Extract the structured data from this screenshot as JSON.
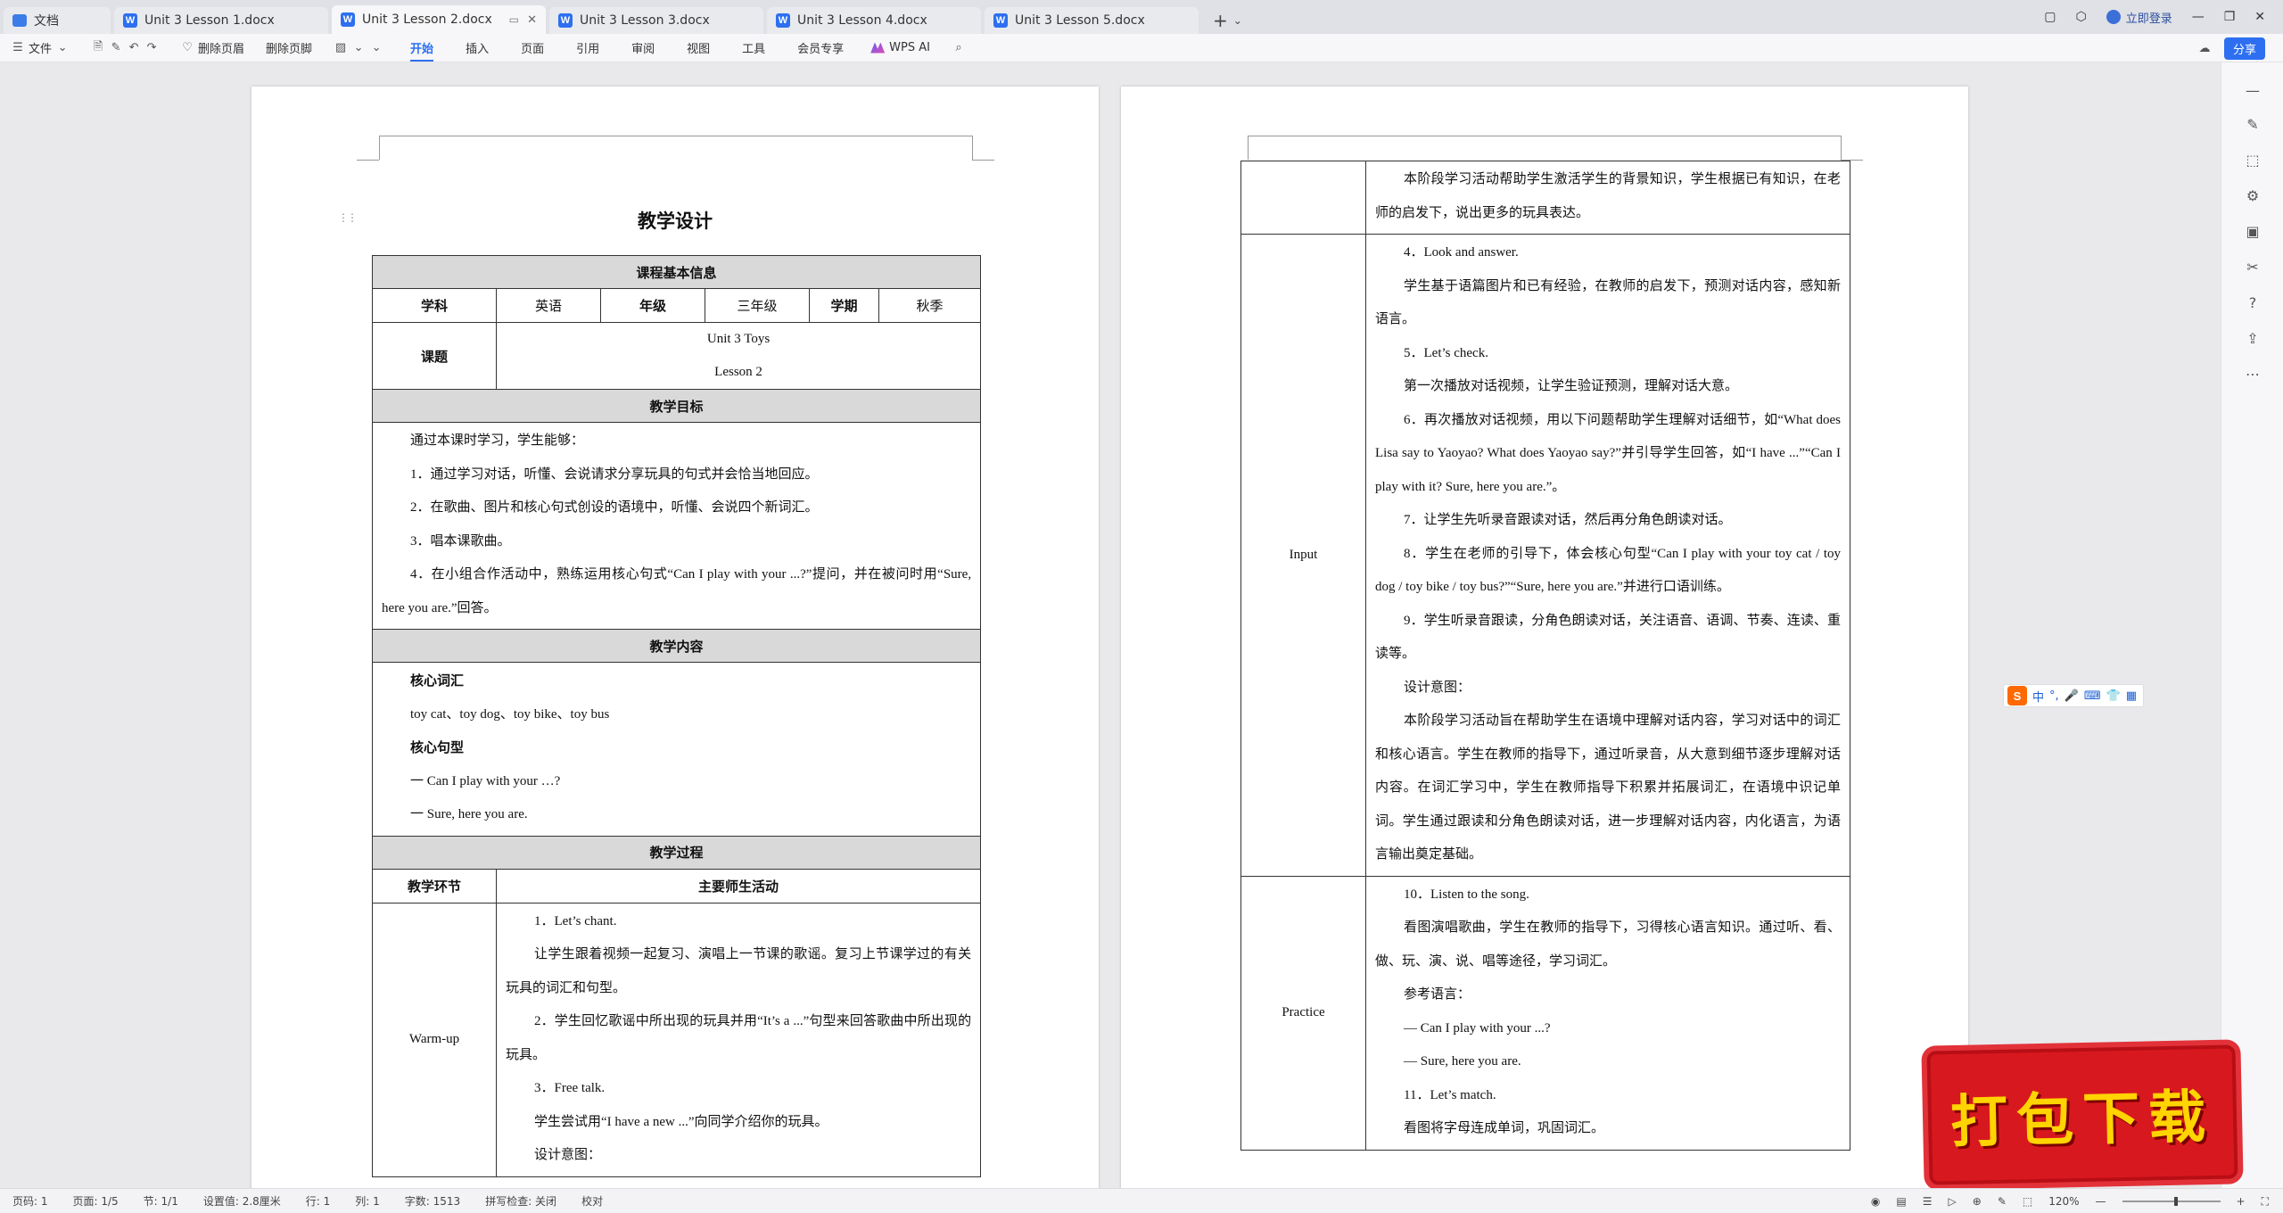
{
  "tabs": [
    {
      "label": "文档",
      "type": "home"
    },
    {
      "label": "Unit 3 Lesson 1.docx",
      "type": "doc"
    },
    {
      "label": "Unit 3 Lesson 2.docx",
      "type": "doc",
      "active": true
    },
    {
      "label": "Unit 3 Lesson 3.docx",
      "type": "doc"
    },
    {
      "label": "Unit 3 Lesson 4.docx",
      "type": "doc"
    },
    {
      "label": "Unit 3 Lesson 5.docx",
      "type": "doc"
    }
  ],
  "topbar": {
    "login": "立即登录",
    "add_tab": "+"
  },
  "toolbar": {
    "file": "文件",
    "delete_header": "删除页眉",
    "delete_footer": "删除页脚",
    "menus": [
      "开始",
      "插入",
      "页面",
      "引用",
      "审阅",
      "视图",
      "工具",
      "会员专享"
    ],
    "wps_ai": "WPS AI",
    "share": "分享"
  },
  "doc1": {
    "title": "教学设计",
    "basic_info": "课程基本信息",
    "subject_label": "学科",
    "subject": "英语",
    "grade_label": "年级",
    "grade": "三年级",
    "term_label": "学期",
    "term": "秋季",
    "topic_label": "课题",
    "topic_line1": "Unit 3 Toys",
    "topic_line2": "Lesson 2",
    "goals_header": "教学目标",
    "goals_intro": "通过本课时学习，学生能够：",
    "goal1": "1．通过学习对话，听懂、会说请求分享玩具的句式并会恰当地回应。",
    "goal2": "2．在歌曲、图片和核心句式创设的语境中，听懂、会说四个新词汇。",
    "goal3": "3．唱本课歌曲。",
    "goal4": "4．在小组合作活动中，熟练运用核心句式“Can I play with your ...?”提问，并在被问时用“Sure, here you are.”回答。",
    "content_header": "教学内容",
    "vocab_label": "核心词汇",
    "vocab": "toy cat、toy dog、toy bike、toy bus",
    "pattern_label": "核心句型",
    "pattern1": "一  Can I play with your …?",
    "pattern2": "一  Sure, here you are.",
    "process_header": "教学过程",
    "stage_col": "教学环节",
    "activity_col": "主要师生活动",
    "warmup": "Warm-up",
    "w1": "1．Let’s chant.",
    "w2": "让学生跟着视频一起复习、演唱上一节课的歌谣。复习上节课学过的有关玩具的词汇和句型。",
    "w3": "2．学生回忆歌谣中所出现的玩具并用“It’s a ...”句型来回答歌曲中所出现的玩具。",
    "w4": "3．Free talk.",
    "w5": "学生尝试用“I have a new ...”向同学介绍你的玩具。",
    "w6": "设计意图："
  },
  "doc2": {
    "top_text": "本阶段学习活动帮助学生激活学生的背景知识，学生根据已有知识，在老师的启发下，说出更多的玩具表达。",
    "input_label": "Input",
    "i1": "4．Look and answer.",
    "i2": "学生基于语篇图片和已有经验，在教师的启发下，预测对话内容，感知新语言。",
    "i3": "5．Let’s check.",
    "i4": "第一次播放对话视频，让学生验证预测，理解对话大意。",
    "i5": "6．再次播放对话视频，用以下问题帮助学生理解对话细节，如“What does Lisa say to Yaoyao? What does Yaoyao say?”并引导学生回答，如“I have ...”“Can I play with it? Sure, here you are.”。",
    "i6": "7．让学生先听录音跟读对话，然后再分角色朗读对话。",
    "i7": "8．学生在老师的引导下，体会核心句型“Can I play with your toy cat / toy dog / toy bike / toy bus?”“Sure, here you are.”并进行口语训练。",
    "i8": "9．学生听录音跟读，分角色朗读对话，关注语音、语调、节奏、连读、重读等。",
    "i9": "设计意图：",
    "i10": "本阶段学习活动旨在帮助学生在语境中理解对话内容，学习对话中的词汇和核心语言。学生在教师的指导下，通过听录音，从大意到细节逐步理解对话内容。在词汇学习中，学生在教师指导下积累并拓展词汇，在语境中识记单词。学生通过跟读和分角色朗读对话，进一步理解对话内容，内化语言，为语言输出奠定基础。",
    "practice_label": "Practice",
    "p1": "10．Listen to the song.",
    "p2": "看图演唱歌曲，学生在教师的指导下，习得核心语言知识。通过听、看、做、玩、演、说、唱等途径，学习词汇。",
    "p3": "参考语言：",
    "p4": "— Can I play with your ...?",
    "p5": "— Sure, here you are.",
    "p6": "11．Let’s match.",
    "p7": "看图将字母连成单词，巩固词汇。"
  },
  "ime": {
    "lang": "中"
  },
  "banner": {
    "text": "打包下载"
  },
  "status": {
    "page": "页码: 1",
    "pages": "页面: 1/5",
    "section": "节: 1/1",
    "setting": "设置值: 2.8厘米",
    "row": "行: 1",
    "col": "列: 1",
    "words": "字数: 1513",
    "spell": "拼写检查: 关闭",
    "proof": "校对",
    "zoom": "120%"
  }
}
